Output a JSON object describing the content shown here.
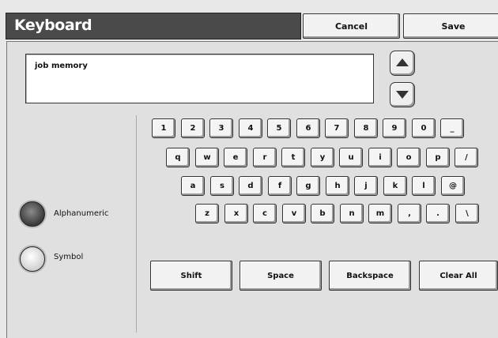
{
  "header": {
    "title": "Keyboard",
    "cancel_label": "Cancel",
    "save_label": "Save"
  },
  "entry": {
    "value": "job memory"
  },
  "keyboard": {
    "rows": [
      [
        "1",
        "2",
        "3",
        "4",
        "5",
        "6",
        "7",
        "8",
        "9",
        "0",
        "_"
      ],
      [
        "q",
        "w",
        "e",
        "r",
        "t",
        "y",
        "u",
        "i",
        "o",
        "p",
        "/"
      ],
      [
        "a",
        "s",
        "d",
        "f",
        "g",
        "h",
        "j",
        "k",
        "l",
        "@"
      ],
      [
        "z",
        "x",
        "c",
        "v",
        "b",
        "n",
        "m",
        ",",
        ".",
        "\\"
      ]
    ]
  },
  "modes": {
    "alphanumeric_label": "Alphanumeric",
    "symbol_label": "Symbol",
    "selected": "Alphanumeric"
  },
  "actions": {
    "shift_label": "Shift",
    "space_label": "Space",
    "backspace_label": "Backspace",
    "clear_label": "Clear All"
  },
  "icons": {
    "scroll_up": "triangle-up-icon",
    "scroll_down": "triangle-down-icon"
  }
}
